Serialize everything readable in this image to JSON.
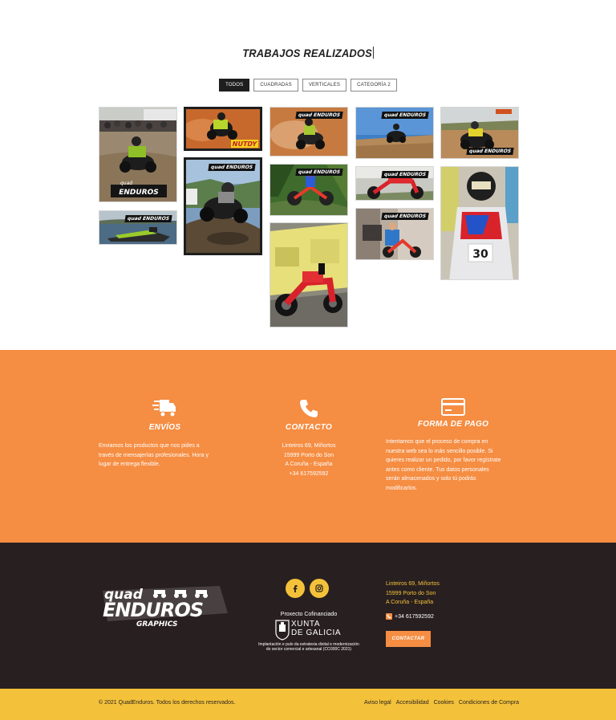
{
  "gallery": {
    "title": "TRABAJOS REALIZADOS",
    "filters": [
      "TODOS",
      "CUADRADAS",
      "VERTICALES",
      "CATEGORÍA 2"
    ],
    "active_filter": "TODOS",
    "badge_text": "quad ENDUROS",
    "badge_sub": "GRAPHICS",
    "sponsor_text": "NUTDY",
    "rider_number": "30"
  },
  "info": {
    "envios": {
      "icon": "truck-icon",
      "heading": "ENVÍOS",
      "lines": [
        "Enviamos los productos que nos pides a",
        "través de mensajerías profesionales. Hora y",
        "lugar de entrega flexible."
      ]
    },
    "contacto": {
      "icon": "phone-icon",
      "heading": "CONTACTO",
      "lines": [
        "Linteiros 69, Miñortos",
        "15999 Porto do Son",
        "A Coruña - España",
        "+34 617592592"
      ]
    },
    "pago": {
      "icon": "credit-card-icon",
      "heading": "FORMA DE PAGO",
      "lines": [
        "Intentamos que el proceso de compra en",
        "nuestra web sea lo más sencillo posible. Si",
        "quieres realizar un pedido, por favor regístrate",
        "antes como cliente. Tus datos personales",
        "serán almacenados y solo tú podrás",
        "modificarlos."
      ]
    }
  },
  "footer": {
    "brand_top": "quad",
    "brand_main": "ENDUROS",
    "brand_sub": "GRAPHICS",
    "coop_label": "Proxecto Cofinanciado",
    "xunta_line1": "XUNTA",
    "xunta_line2": "DE GALICIA",
    "implementation_line1": "Implantación e pulo da estratexia dixital e modernización",
    "implementation_line2": "do sector comercial e artesanal (CO300C 2021)",
    "address_lines": [
      "Linteiros 69, Miñortos",
      "15999 Porto do Son",
      "A Coruña - España"
    ],
    "phone": "+34 617592592",
    "contact_button": "CONTACTAR",
    "copyright": "© 2021 QuadEnduros. Todos los derechos reservados.",
    "legal_links": [
      "Aviso legal",
      "Accesibilidad",
      "Cookies",
      "Condiciones de Compra"
    ]
  },
  "colors": {
    "orange": "#f58d42",
    "dark": "#281f20",
    "yellow": "#f3c23a"
  }
}
